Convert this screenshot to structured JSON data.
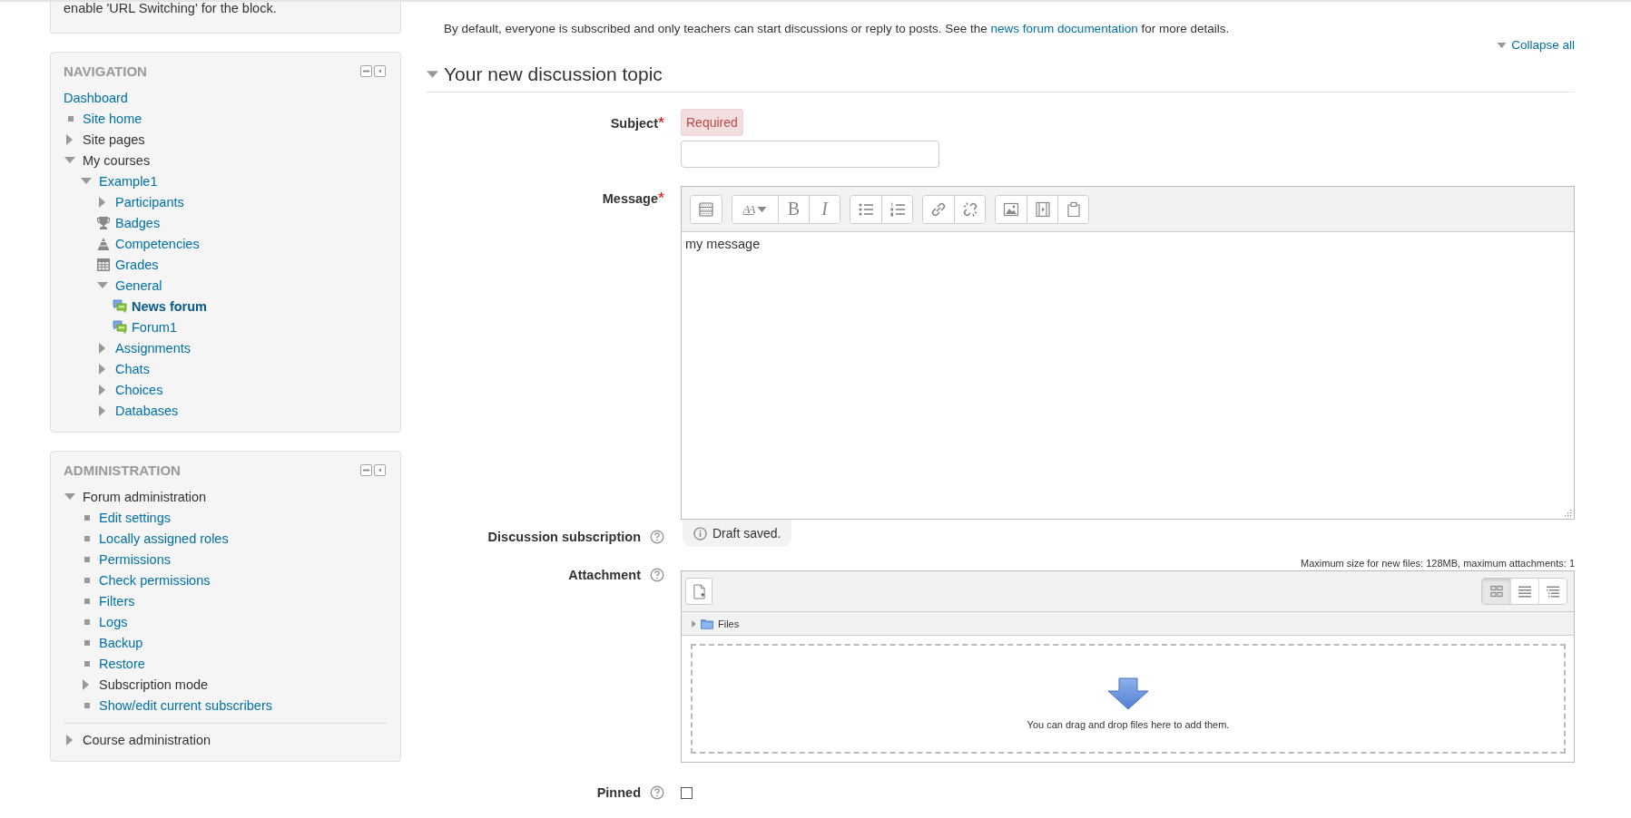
{
  "top_block": {
    "text": "enable 'URL Switching' for the block."
  },
  "navigation": {
    "title": "NAVIGATION",
    "items": [
      {
        "label": "Dashboard",
        "kind": "none",
        "link": true,
        "selected": false
      },
      {
        "label": "Site home",
        "kind": "bullet",
        "link": true,
        "selected": false
      },
      {
        "label": "Site pages",
        "kind": "branch",
        "expanded": false,
        "link": false,
        "selected": false
      },
      {
        "label": "My courses",
        "kind": "branch",
        "expanded": true,
        "link": false,
        "selected": false,
        "children": [
          {
            "label": "Example1",
            "kind": "branch",
            "expanded": true,
            "link": true,
            "selected": false,
            "children": [
              {
                "label": "Participants",
                "kind": "branch",
                "expanded": false,
                "link": true,
                "selected": false
              },
              {
                "label": "Badges",
                "kind": "trophy",
                "link": true,
                "selected": false
              },
              {
                "label": "Competencies",
                "kind": "pyramid",
                "link": true,
                "selected": false
              },
              {
                "label": "Grades",
                "kind": "table",
                "link": true,
                "selected": false
              },
              {
                "label": "General",
                "kind": "branch",
                "expanded": true,
                "link": true,
                "selected": false,
                "children": [
                  {
                    "label": "News forum",
                    "kind": "forum",
                    "link": true,
                    "selected": true
                  },
                  {
                    "label": "Forum1",
                    "kind": "forum",
                    "link": true,
                    "selected": false
                  }
                ]
              },
              {
                "label": "Assignments",
                "kind": "branch",
                "expanded": false,
                "link": true,
                "selected": false
              },
              {
                "label": "Chats",
                "kind": "branch",
                "expanded": false,
                "link": true,
                "selected": false
              },
              {
                "label": "Choices",
                "kind": "branch",
                "expanded": false,
                "link": true,
                "selected": false
              },
              {
                "label": "Databases",
                "kind": "branch",
                "expanded": false,
                "link": true,
                "selected": false
              }
            ]
          }
        ]
      }
    ]
  },
  "administration": {
    "title": "ADMINISTRATION",
    "items": [
      {
        "label": "Forum administration",
        "kind": "branch",
        "expanded": true,
        "link": false,
        "selected": false,
        "children": [
          {
            "label": "Edit settings",
            "kind": "bullet",
            "link": true,
            "selected": false
          },
          {
            "label": "Locally assigned roles",
            "kind": "bullet",
            "link": true,
            "selected": false
          },
          {
            "label": "Permissions",
            "kind": "bullet",
            "link": true,
            "selected": false
          },
          {
            "label": "Check permissions",
            "kind": "bullet",
            "link": true,
            "selected": false
          },
          {
            "label": "Filters",
            "kind": "bullet",
            "link": true,
            "selected": false
          },
          {
            "label": "Logs",
            "kind": "bullet",
            "link": true,
            "selected": false
          },
          {
            "label": "Backup",
            "kind": "bullet",
            "link": true,
            "selected": false
          },
          {
            "label": "Restore",
            "kind": "bullet",
            "link": true,
            "selected": false
          },
          {
            "label": "Subscription mode",
            "kind": "branch",
            "expanded": false,
            "link": false,
            "selected": false
          },
          {
            "label": "Show/edit current subscribers",
            "kind": "bullet",
            "link": true,
            "selected": false
          }
        ]
      },
      {
        "label": "Course administration",
        "kind": "branch",
        "expanded": false,
        "link": false,
        "selected": false
      }
    ]
  },
  "intro": {
    "before": "By default, everyone is subscribed and only teachers can start discussions or reply to posts. See the",
    "link": "news forum documentation",
    "after": "for more details."
  },
  "collapse_all": "Collapse all",
  "section": {
    "title": "Your new discussion topic",
    "expanded": true
  },
  "subject": {
    "label": "Subject",
    "required": true,
    "error": "Required"
  },
  "message": {
    "label": "Message",
    "required": true,
    "value": "my message",
    "toolbar": [
      [
        {
          "kind": "toggle"
        }
      ],
      [
        {
          "kind": "font",
          "text": "AA"
        },
        {
          "kind": "bold",
          "text": "B"
        },
        {
          "kind": "italic",
          "text": "I"
        }
      ],
      [
        {
          "kind": "bullets"
        },
        {
          "kind": "numbers"
        }
      ],
      [
        {
          "kind": "link"
        },
        {
          "kind": "unlink"
        }
      ],
      [
        {
          "kind": "image"
        },
        {
          "kind": "media"
        },
        {
          "kind": "files"
        }
      ]
    ]
  },
  "draft_notice": "Draft saved.",
  "subscription": {
    "label": "Discussion subscription"
  },
  "attachment": {
    "label": "Attachment",
    "limits": "Maximum size for new files: 128MB, maximum attachments: 1",
    "folder": "Files",
    "drop_text": "You can drag and drop files here to add them.",
    "views": [
      {
        "kind": "icons",
        "selected": true
      },
      {
        "kind": "list",
        "selected": false
      },
      {
        "kind": "tree",
        "selected": false
      }
    ]
  },
  "pinned": {
    "label": "Pinned",
    "checked": false
  }
}
